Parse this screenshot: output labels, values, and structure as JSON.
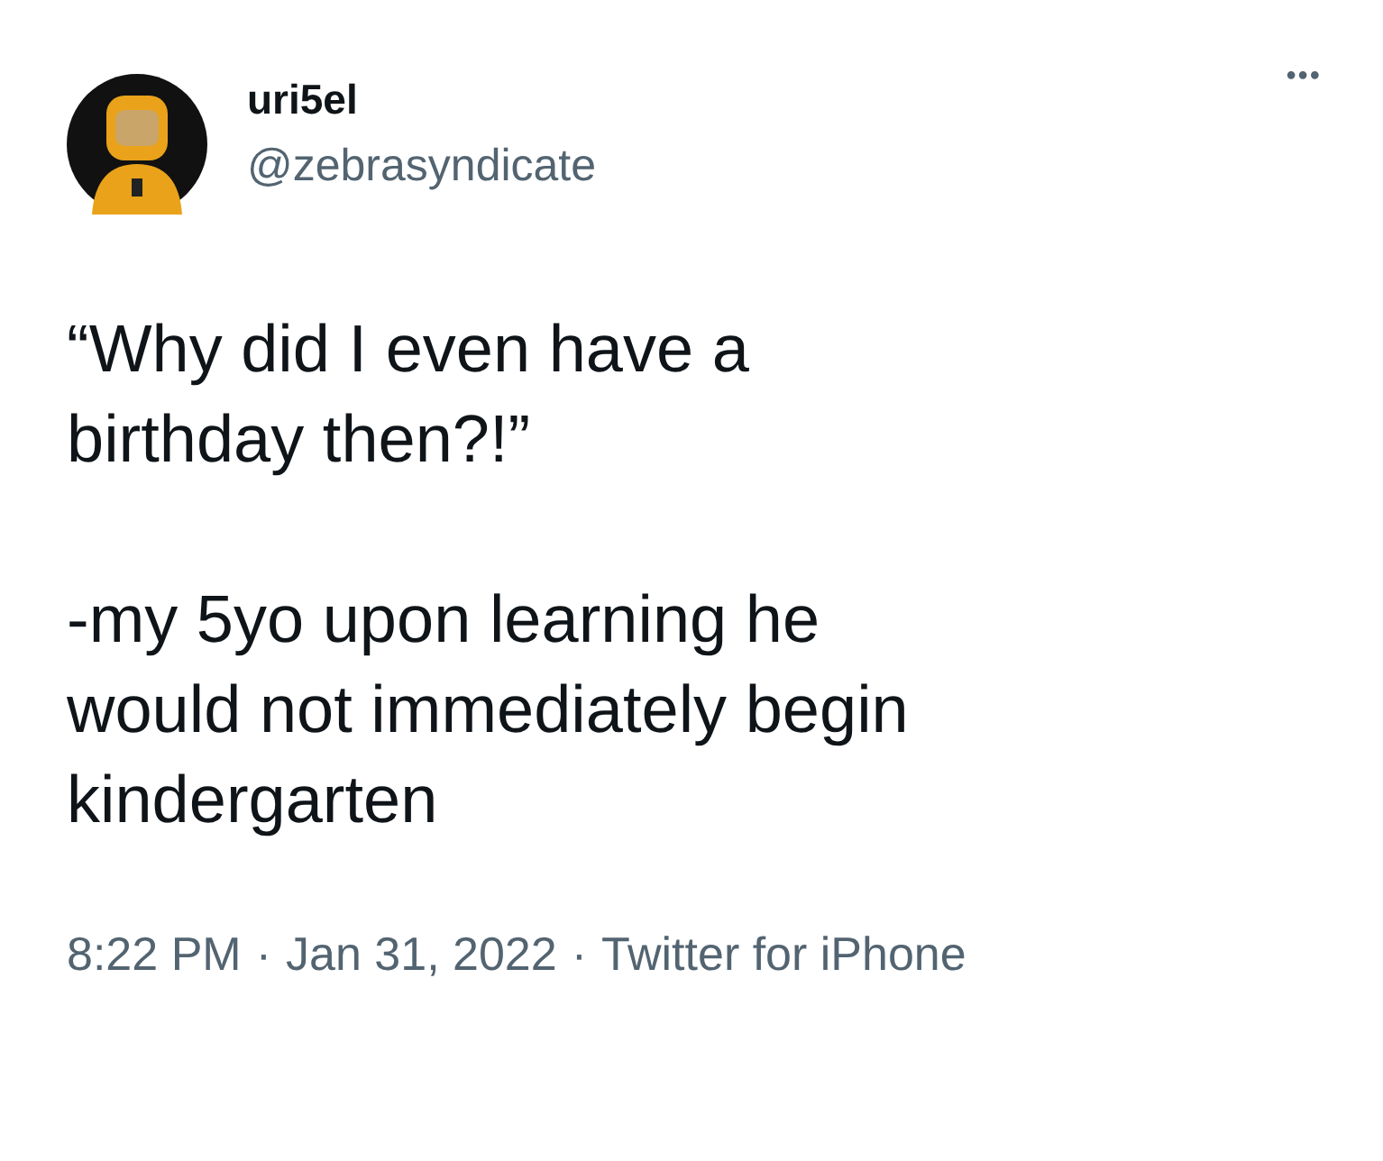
{
  "author": {
    "name": "uri5el",
    "handle": "@zebrasyndicate"
  },
  "more_menu": "•••",
  "paragraphs": [
    [
      "“Why did I even have a",
      "birthday then?!”"
    ],
    [
      "-my 5yo upon learning he",
      "would not immediately begin",
      "kindergarten"
    ]
  ],
  "footer": {
    "items": [
      "8:22 PM",
      "Jan 31, 2022",
      "Twitter for iPhone"
    ],
    "separator": "·"
  }
}
